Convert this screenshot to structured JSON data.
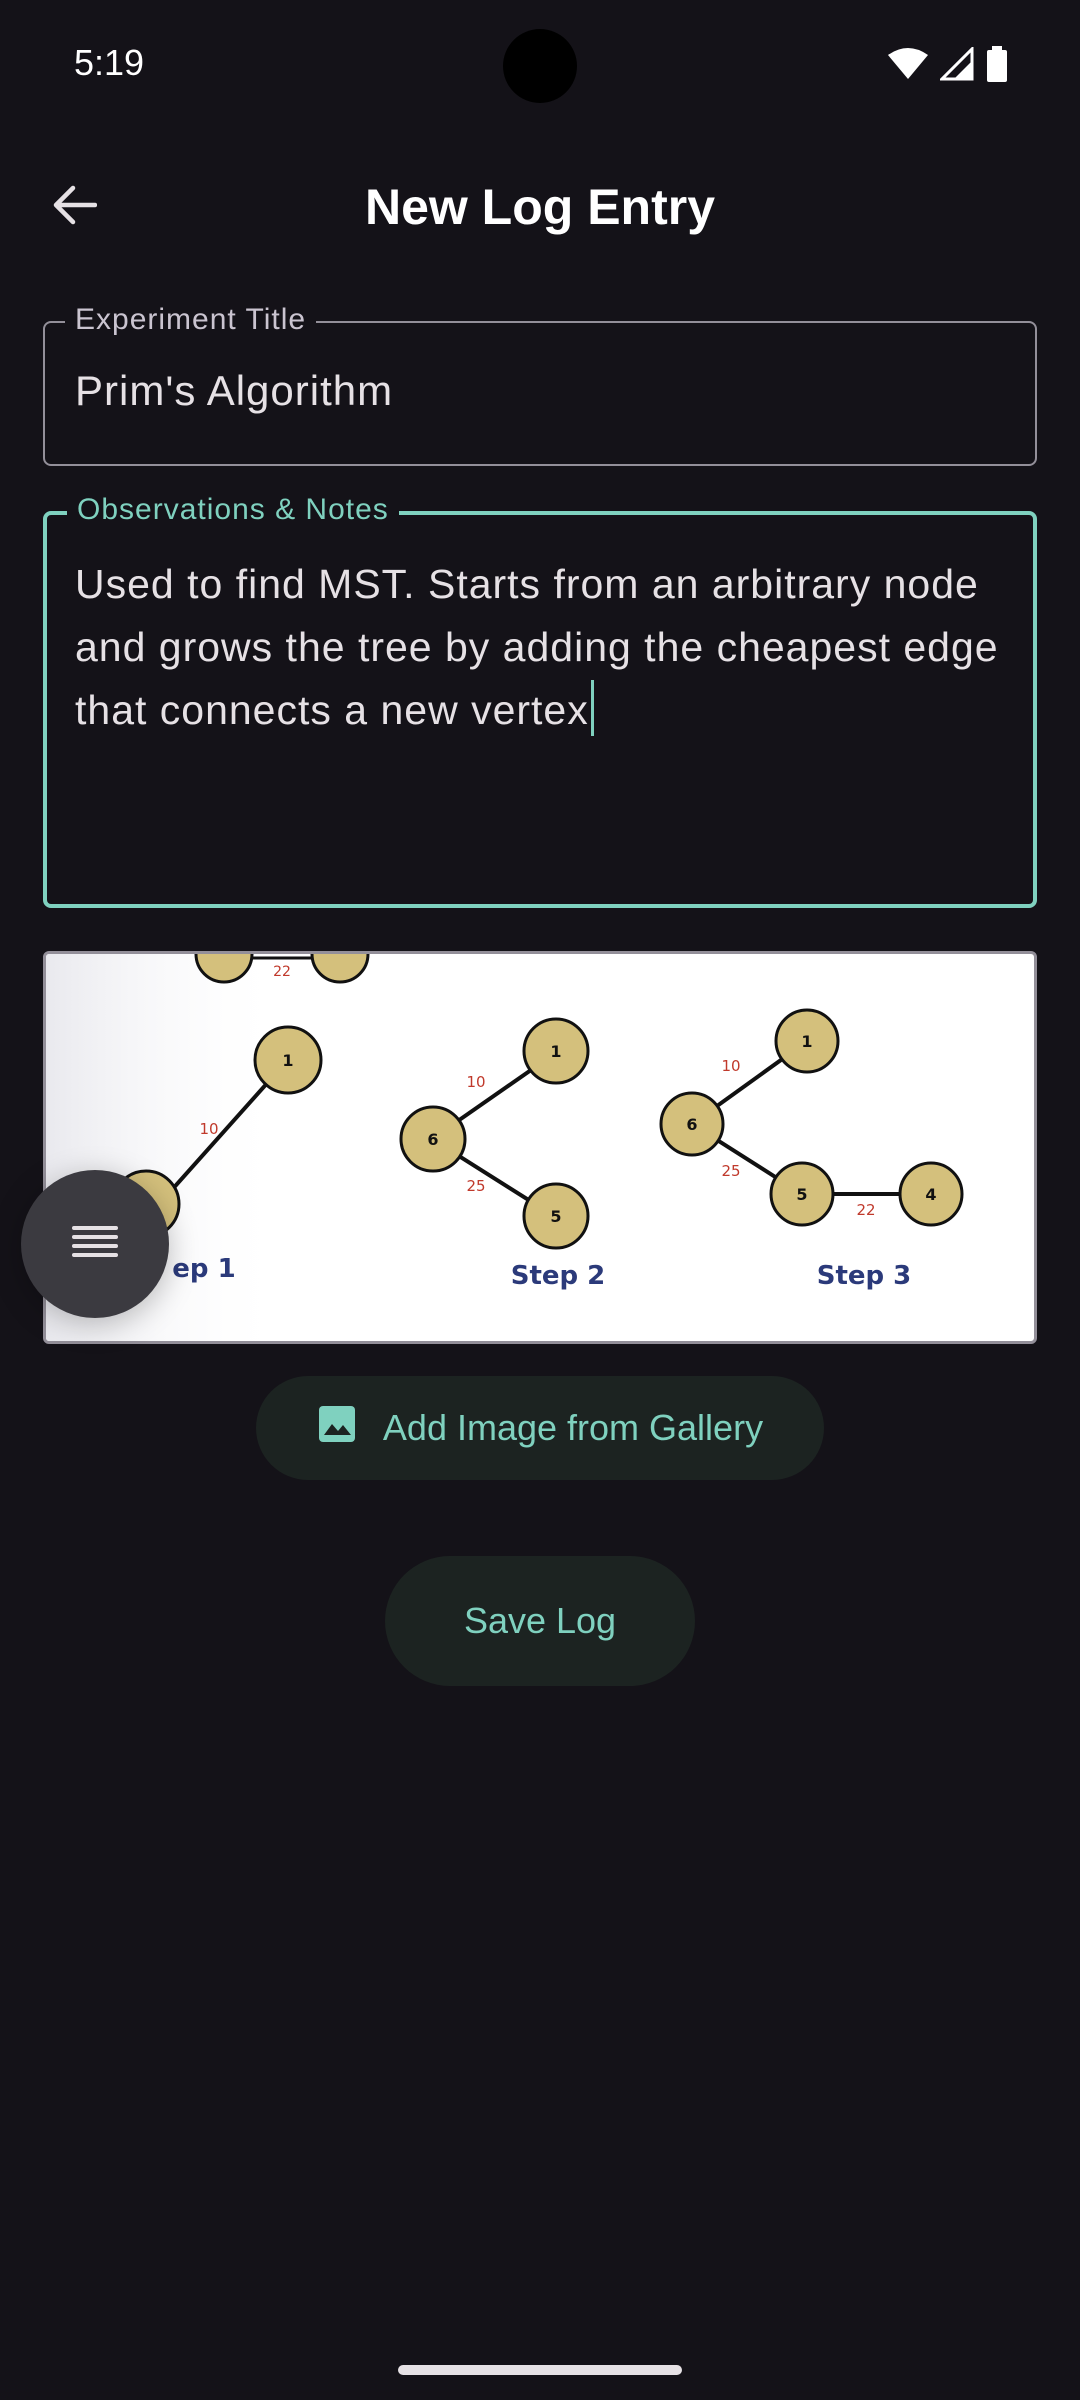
{
  "status_bar": {
    "time": "5:19"
  },
  "app_bar": {
    "title": "New Log Entry",
    "back_icon": "arrow-back-icon"
  },
  "form": {
    "title_field": {
      "label": "Experiment Title",
      "value": "Prim's Algorithm"
    },
    "notes_field": {
      "label": "Observations & Notes",
      "value": "Used to find MST. Starts from an arbitrary node and grows the tree by adding the cheapest edge that connects a new vertex"
    }
  },
  "image_preview": {
    "steps": [
      "Step 1",
      "Step 2",
      "Step 3"
    ],
    "step1_partial_label": "ep 1",
    "node_labels": [
      "1",
      "6",
      "5",
      "4"
    ],
    "edge_labels": [
      "10",
      "25",
      "22"
    ]
  },
  "buttons": {
    "gallery_label": "Add Image from Gallery",
    "save_label": "Save Log"
  },
  "colors": {
    "background": "#141218",
    "accent": "#7fd1bf",
    "outline": "#938f99",
    "node_fill": "#d4c07c",
    "step_label": "#2b3a7a",
    "edge_label": "#c0392b"
  }
}
